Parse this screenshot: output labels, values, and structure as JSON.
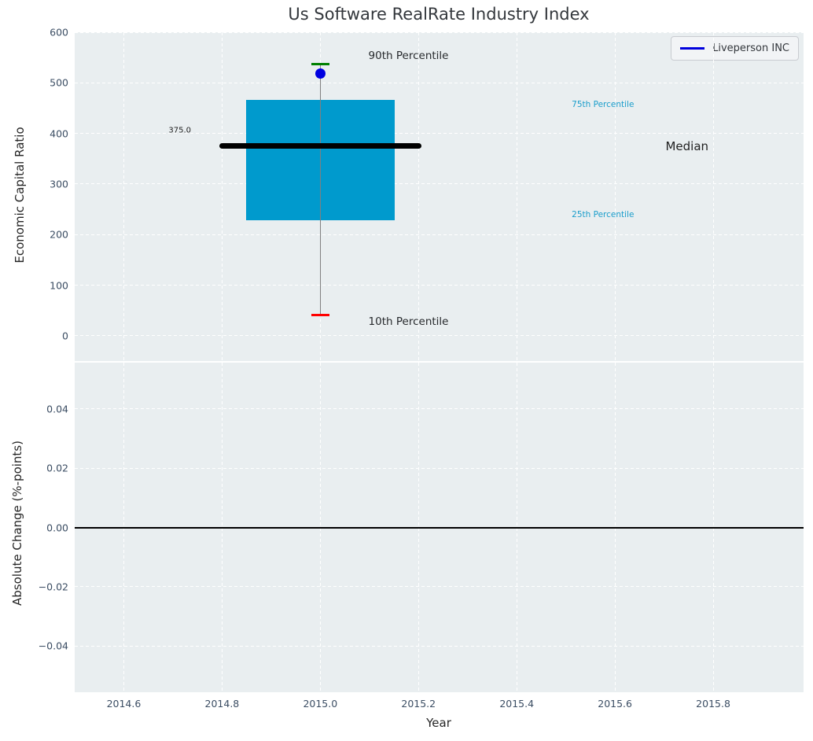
{
  "figure": {
    "title": "Us Software RealRate Industry Index"
  },
  "legend": {
    "label": "Liveperson INC",
    "line_color": "#0000dd"
  },
  "colors": {
    "axes_background": "#e9eef0",
    "grid": "#ffffff",
    "tick_text": "#3b4d63",
    "box_fill": "#009ACD",
    "median_line": "#000000",
    "whisker_line": "#808080",
    "p90_cap": "#008000",
    "p10_cap": "#ff0000",
    "company_dot": "#0000e0",
    "percentile_text": "#1a9dcb",
    "annotation_text": "#1f1f1f",
    "zero_line": "#000000"
  },
  "chart_data": [
    {
      "type": "bar",
      "subtype": "boxplot-single",
      "title": "Us Software RealRate Industry Index",
      "ylabel": "Economic Capital Ratio",
      "xlim": [
        2014.5,
        2015.984
      ],
      "ylim": [
        -50,
        600
      ],
      "grid": "white dashed, on",
      "legend_position": "upper right",
      "yticks": [
        {
          "v": 600,
          "label": "600"
        },
        {
          "v": 500,
          "label": "500"
        },
        {
          "v": 400,
          "label": "400"
        },
        {
          "v": 300,
          "label": "300"
        },
        {
          "v": 200,
          "label": "200"
        },
        {
          "v": 100,
          "label": "100"
        },
        {
          "v": 0,
          "label": "0"
        }
      ],
      "box": {
        "x": 2015.0,
        "box_halfwidth": 0.151,
        "median_halfwidth": 0.206,
        "cap_halfwidth": 0.018,
        "p10": 41,
        "p25": 228,
        "median": 375,
        "p75": 467,
        "p90": 537
      },
      "series": [
        {
          "name": "Liveperson INC",
          "x": 2015.0,
          "value": 519,
          "marker": "circle"
        }
      ],
      "annotations": [
        {
          "name": "median-value-label",
          "text": "375.0",
          "x": 2014.737,
          "y": 406,
          "size": 10,
          "color": "#1f1f1f",
          "anchor": "right"
        },
        {
          "name": "p90-annotation",
          "text": "90th Percentile",
          "x": 2015.098,
          "y": 553,
          "size": 13.5,
          "color": "#26292c",
          "anchor": "left"
        },
        {
          "name": "p10-annotation",
          "text": "10th Percentile",
          "x": 2015.098,
          "y": 28,
          "size": 13.5,
          "color": "#26292c",
          "anchor": "left"
        },
        {
          "name": "p75-annotation",
          "text": "75th Percentile",
          "x": 2015.512,
          "y": 457,
          "size": 10.5,
          "color": "#1a9dcb",
          "anchor": "left"
        },
        {
          "name": "p25-annotation",
          "text": "25th Percentile",
          "x": 2015.512,
          "y": 240,
          "size": 10.5,
          "color": "#1a9dcb",
          "anchor": "left"
        },
        {
          "name": "median-annotation",
          "text": "Median",
          "x": 2015.703,
          "y": 374,
          "size": 15,
          "color": "#1f1f1f",
          "anchor": "left"
        }
      ]
    },
    {
      "type": "line",
      "subtype": "zero-reference",
      "ylabel": "Absolute Change (%-points)",
      "xlabel": "Year",
      "xlim": [
        2014.5,
        2015.984
      ],
      "ylim": [
        -0.0555,
        0.0555
      ],
      "grid": "white dashed, on",
      "yticks": [
        {
          "v": 0.04,
          "label": "0.04"
        },
        {
          "v": 0.02,
          "label": "0.02"
        },
        {
          "v": 0,
          "label": "0.00"
        },
        {
          "v": -0.02,
          "label": "−0.02"
        },
        {
          "v": -0.04,
          "label": "−0.04"
        }
      ],
      "zero_line": {
        "y": 0
      }
    }
  ],
  "x_axis": {
    "label": "Year",
    "ticks": [
      {
        "v": 2014.6,
        "label": "2014.6"
      },
      {
        "v": 2014.8,
        "label": "2014.8"
      },
      {
        "v": 2015.0,
        "label": "2015.0"
      },
      {
        "v": 2015.2,
        "label": "2015.2"
      },
      {
        "v": 2015.4,
        "label": "2015.4"
      },
      {
        "v": 2015.6,
        "label": "2015.6"
      },
      {
        "v": 2015.8,
        "label": "2015.8"
      }
    ]
  }
}
